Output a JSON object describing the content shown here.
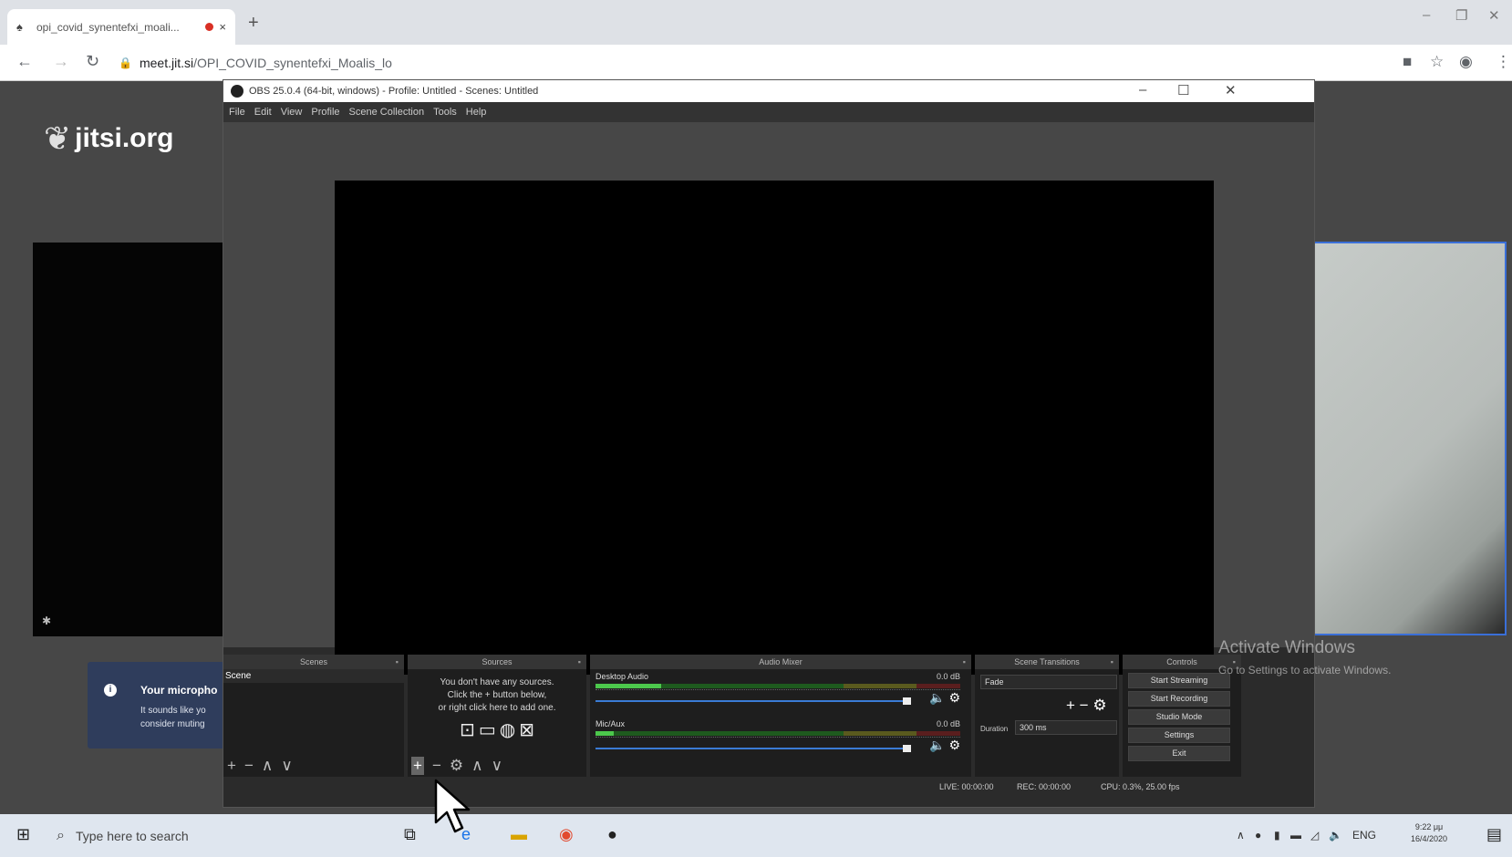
{
  "browser": {
    "tab_title": "opi_covid_synentefxi_moali...",
    "tab_close": "×",
    "new_tab": "+",
    "url_host": "meet.jit.si",
    "url_path": "/OPI_COVID_synentefxi_Moalis_lo",
    "window_controls": [
      "–",
      "❐",
      "✕"
    ]
  },
  "jitsi": {
    "logo_text": "jitsi.org",
    "notification": {
      "title": "Your micropho",
      "body": "It sounds like yo\nconsider muting"
    },
    "activate": {
      "line1": "Activate Windows",
      "line2": "Go to Settings to activate Windows."
    }
  },
  "obs": {
    "title": "OBS 25.0.4 (64-bit, windows) - Profile: Untitled - Scenes: Untitled",
    "window_controls": [
      "–",
      "☐",
      "✕"
    ],
    "menu": [
      "File",
      "Edit",
      "View",
      "Profile",
      "Scene Collection",
      "Tools",
      "Help"
    ],
    "docks": {
      "scenes": {
        "title": "Scenes",
        "items": [
          "Scene"
        ]
      },
      "sources": {
        "title": "Sources",
        "empty_line1": "You don't have any sources.",
        "empty_line2": "Click the + button below,",
        "empty_line3": "or right click here to add one."
      },
      "mixer": {
        "title": "Audio Mixer",
        "channels": [
          {
            "name": "Desktop Audio",
            "db": "0.0 dB",
            "level": 0.18
          },
          {
            "name": "Mic/Aux",
            "db": "0.0 dB",
            "level": 0.05
          }
        ]
      },
      "transitions": {
        "title": "Scene Transitions",
        "selected": "Fade",
        "duration_label": "Duration",
        "duration": "300 ms"
      },
      "controls": {
        "title": "Controls",
        "buttons": [
          "Start Streaming",
          "Start Recording",
          "Studio Mode",
          "Settings",
          "Exit"
        ]
      }
    },
    "status": {
      "live": "LIVE: 00:00:00",
      "rec": "REC: 00:00:00",
      "cpu": "CPU: 0.3%, 25.00 fps"
    }
  },
  "taskbar": {
    "search_placeholder": "Type here to search",
    "lang": "ENG",
    "time": "9:22 μμ",
    "date": "16/4/2020"
  },
  "colors": {
    "obs_bg": "#2b2b2b",
    "jitsi_bg": "#474747",
    "accent_blue": "#3a7bd5",
    "notification_bg": "#2f3d5c"
  }
}
